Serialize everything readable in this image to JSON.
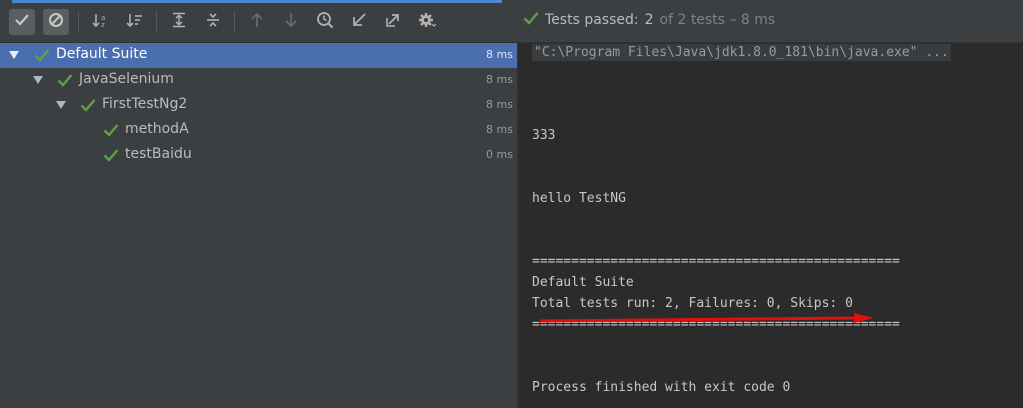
{
  "toolbar": {
    "buttons": [
      {
        "icon": "show-passed-icon",
        "active": true
      },
      {
        "icon": "show-ignored-icon",
        "active": true
      },
      {
        "icon": "sort-alphabetically-icon"
      },
      {
        "icon": "sort-by-duration-icon"
      },
      {
        "icon": "expand-all-icon"
      },
      {
        "icon": "collapse-all-icon"
      },
      {
        "icon": "previous-occurrence-icon"
      },
      {
        "icon": "next-occurrence-icon"
      },
      {
        "icon": "test-history-icon"
      },
      {
        "icon": "import-tests-icon"
      },
      {
        "icon": "export-tests-icon"
      },
      {
        "icon": "settings-gear-icon"
      }
    ],
    "status": {
      "label": "Tests passed:",
      "count": "2",
      "detail": "of 2 tests – 8 ms",
      "color": "#5fa043"
    }
  },
  "tree": {
    "nodes": [
      {
        "name": "Default Suite",
        "time": "8 ms",
        "level": 0,
        "expanded": true,
        "selected": true
      },
      {
        "name": "JavaSelenium",
        "time": "8 ms",
        "level": 1,
        "expanded": true
      },
      {
        "name": "FirstTestNg2",
        "time": "8 ms",
        "level": 2,
        "expanded": true
      },
      {
        "name": "methodA",
        "time": "8 ms",
        "level": 3
      },
      {
        "name": "testBaidu",
        "time": "0 ms",
        "level": 3
      }
    ]
  },
  "console": {
    "command": "\"C:\\Program Files\\Java\\jdk1.8.0_181\\bin\\java.exe\" ...",
    "line1": "333",
    "line2": "hello TestNG",
    "separator": "===============================================",
    "suite": "Default Suite",
    "summary": "Total tests run: 2, Failures: 0, Skips: 0",
    "separator2": "===============================================",
    "exit": "Process finished with exit code 0"
  },
  "colors": {
    "pass": "#5fa043",
    "selection": "#4b6eaf",
    "annotation_arrow": "#e01010"
  }
}
